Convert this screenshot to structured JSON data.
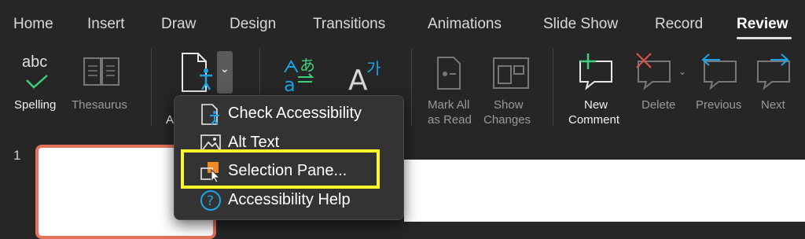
{
  "tabs": [
    {
      "label": "Home"
    },
    {
      "label": "Insert"
    },
    {
      "label": "Draw"
    },
    {
      "label": "Design"
    },
    {
      "label": "Transitions"
    },
    {
      "label": "Animations"
    },
    {
      "label": "Slide Show"
    },
    {
      "label": "Record"
    },
    {
      "label": "Review",
      "active": true
    }
  ],
  "ribbon": {
    "spelling_icon_text": "abc",
    "spelling": "Spelling",
    "thesaurus": "Thesaurus",
    "accessibility_partial": "A",
    "mark_all_read_1": "Mark All",
    "mark_all_read_2": "as Read",
    "show_changes_1": "Show",
    "show_changes_2": "Changes",
    "new_comment_1": "New",
    "new_comment_2": "Comment",
    "delete": "Delete",
    "previous": "Previous",
    "next": "Next"
  },
  "slides": {
    "current_number": "1"
  },
  "accessibility_menu": {
    "items": [
      {
        "label": "Check Accessibility",
        "icon": "accessibility-doc-icon"
      },
      {
        "label": "Alt Text",
        "icon": "alt-text-image-icon"
      },
      {
        "label": "Selection Pane...",
        "icon": "selection-pane-icon"
      },
      {
        "label": "Accessibility Help",
        "icon": "help-circle-icon"
      }
    ]
  },
  "colors": {
    "highlight": "#f7f72a",
    "accent_blue": "#1fa3e8",
    "accent_green": "#3fcf7a",
    "accent_red": "#e0554a",
    "thumb_border": "#e2725b",
    "selection_orange": "#f08a24"
  }
}
